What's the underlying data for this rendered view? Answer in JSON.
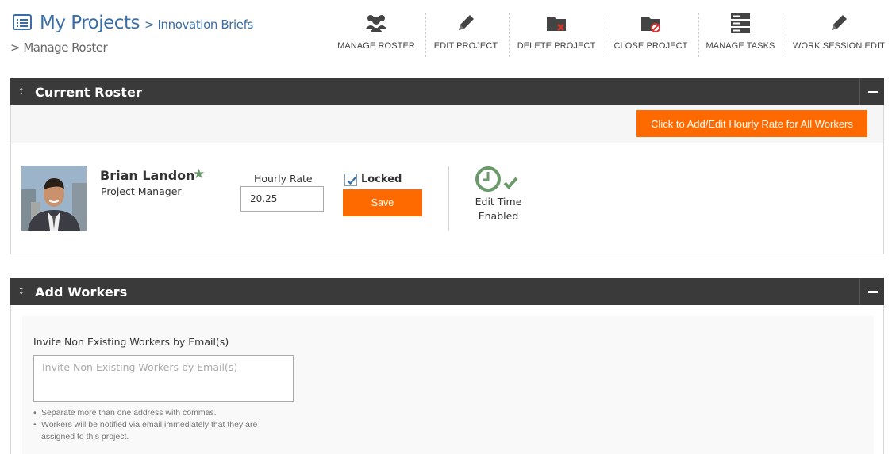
{
  "header": {
    "title": "My Projects",
    "separator": ">",
    "project": "Innovation Briefs",
    "breadcrumb": "> Manage Roster"
  },
  "toolbar": {
    "items": [
      {
        "label": "MANAGE ROSTER",
        "icon": "group-icon"
      },
      {
        "label": "EDIT PROJECT",
        "icon": "pencil-icon"
      },
      {
        "label": "DELETE PROJECT",
        "icon": "folder-delete-icon"
      },
      {
        "label": "CLOSE PROJECT",
        "icon": "folder-close-icon"
      },
      {
        "label": "MANAGE TASKS",
        "icon": "server-icon"
      },
      {
        "label": "WORK SESSION EDIT",
        "icon": "pencil-icon"
      }
    ]
  },
  "roster_panel": {
    "title": "Current Roster",
    "rate_all_button": "Click to Add/Edit Hourly Rate for All Workers",
    "worker": {
      "name": "Brian Landon",
      "role": "Project Manager",
      "rate_label": "Hourly Rate",
      "rate_value": "20.25",
      "locked_label": "Locked",
      "locked": true,
      "save_label": "Save",
      "edit_time_line1": "Edit Time",
      "edit_time_line2": "Enabled"
    }
  },
  "workers_panel": {
    "title": "Add Workers",
    "invite_label": "Invite Non Existing Workers by Email(s)",
    "invite_placeholder": "Invite Non Existing Workers by Email(s)",
    "hints": [
      "Separate more than one address with commas.",
      "Workers will be notified via email immediately that they are assigned to this project."
    ]
  },
  "colors": {
    "accent": "#3a6ea5",
    "button": "#ff6a00",
    "panel_header": "#3a3a3a",
    "status_green": "#6a9a6a"
  }
}
